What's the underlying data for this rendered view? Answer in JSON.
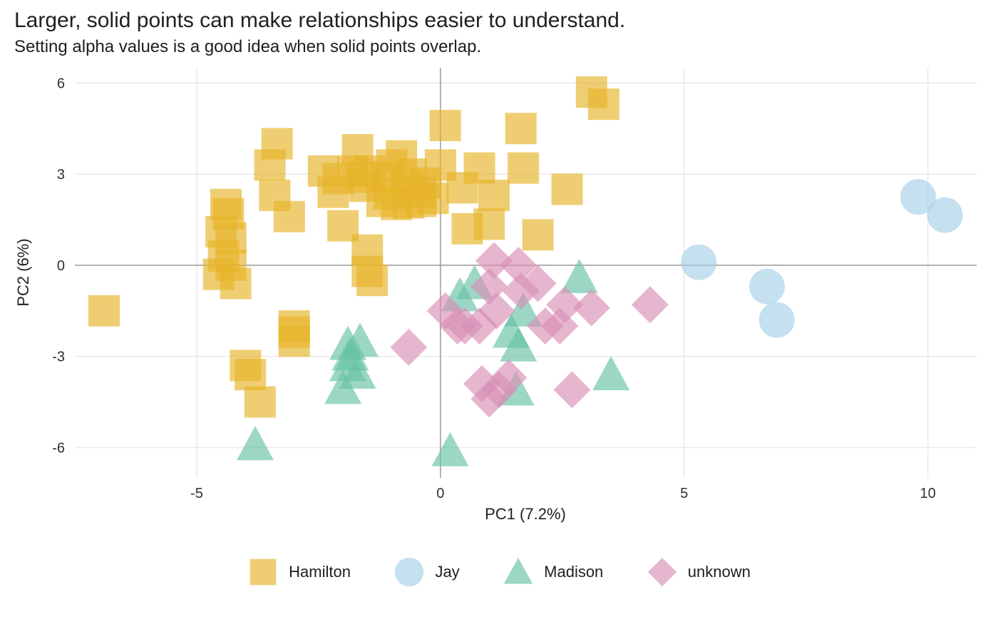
{
  "chart_data": {
    "type": "scatter",
    "title": "Larger, solid points can make relationships easier to understand.",
    "subtitle": "Setting alpha values is a good idea when solid points overlap.",
    "xlabel": "PC1 (7.2%)",
    "ylabel": "PC2 (6%)",
    "xlim": [
      -7.5,
      11
    ],
    "ylim": [
      -7,
      6.5
    ],
    "x_ticks": [
      -5,
      0,
      5,
      10
    ],
    "y_ticks": [
      -6,
      -3,
      0,
      3,
      6
    ],
    "grid": true,
    "alpha": 0.65,
    "legend_position": "bottom",
    "series": [
      {
        "name": "Hamilton",
        "shape": "square",
        "color": "#E7B428",
        "points": [
          {
            "x": -6.9,
            "y": -1.5
          },
          {
            "x": -4.4,
            "y": 2.0
          },
          {
            "x": -4.35,
            "y": 1.7
          },
          {
            "x": -4.5,
            "y": 1.1
          },
          {
            "x": -4.3,
            "y": 0.9
          },
          {
            "x": -4.45,
            "y": 0.3
          },
          {
            "x": -4.3,
            "y": 0.0
          },
          {
            "x": -4.55,
            "y": -0.3
          },
          {
            "x": -4.2,
            "y": -0.6
          },
          {
            "x": -4.0,
            "y": -3.3
          },
          {
            "x": -3.9,
            "y": -3.6
          },
          {
            "x": -3.7,
            "y": -4.5
          },
          {
            "x": -3.35,
            "y": 4.0
          },
          {
            "x": -3.5,
            "y": 3.3
          },
          {
            "x": -3.4,
            "y": 2.3
          },
          {
            "x": -3.1,
            "y": 1.6
          },
          {
            "x": -3.0,
            "y": -2.0
          },
          {
            "x": -3.0,
            "y": -2.2
          },
          {
            "x": -3.0,
            "y": -2.5
          },
          {
            "x": -2.4,
            "y": 3.1
          },
          {
            "x": -2.2,
            "y": 2.4
          },
          {
            "x": -2.0,
            "y": 1.3
          },
          {
            "x": -2.1,
            "y": 2.85
          },
          {
            "x": -1.8,
            "y": 3.1
          },
          {
            "x": -1.7,
            "y": 3.8
          },
          {
            "x": -1.6,
            "y": 2.9
          },
          {
            "x": -1.55,
            "y": 2.6
          },
          {
            "x": -1.45,
            "y": 3.1
          },
          {
            "x": -1.5,
            "y": -0.2
          },
          {
            "x": -1.4,
            "y": -0.5
          },
          {
            "x": -1.5,
            "y": 0.5
          },
          {
            "x": -1.1,
            "y": 2.9
          },
          {
            "x": -1.05,
            "y": 2.35
          },
          {
            "x": -1.2,
            "y": 2.1
          },
          {
            "x": -1.0,
            "y": 3.3
          },
          {
            "x": -0.9,
            "y": 2.0
          },
          {
            "x": -0.8,
            "y": 3.6
          },
          {
            "x": -0.7,
            "y": 2.6
          },
          {
            "x": -0.65,
            "y": 2.05
          },
          {
            "x": -0.6,
            "y": 3.0
          },
          {
            "x": -0.4,
            "y": 2.1
          },
          {
            "x": -0.4,
            "y": 2.4
          },
          {
            "x": -0.3,
            "y": 2.7
          },
          {
            "x": -0.15,
            "y": 2.2
          },
          {
            "x": 0.1,
            "y": 4.6
          },
          {
            "x": 0.0,
            "y": 3.3
          },
          {
            "x": 0.45,
            "y": 2.55
          },
          {
            "x": 0.55,
            "y": 1.2
          },
          {
            "x": 0.8,
            "y": 3.2
          },
          {
            "x": 1.0,
            "y": 1.35
          },
          {
            "x": 1.1,
            "y": 2.3
          },
          {
            "x": 1.7,
            "y": 3.2
          },
          {
            "x": 1.65,
            "y": 4.5
          },
          {
            "x": 2.0,
            "y": 1.0
          },
          {
            "x": 2.6,
            "y": 2.5
          },
          {
            "x": 3.1,
            "y": 5.7
          },
          {
            "x": 3.35,
            "y": 5.3
          }
        ]
      },
      {
        "name": "Jay",
        "shape": "circle",
        "color": "#A6CFE6",
        "points": [
          {
            "x": 5.3,
            "y": 0.1
          },
          {
            "x": 6.7,
            "y": -0.7
          },
          {
            "x": 6.9,
            "y": -1.8
          },
          {
            "x": 9.8,
            "y": 2.25
          },
          {
            "x": 10.35,
            "y": 1.65
          }
        ]
      },
      {
        "name": "Madison",
        "shape": "triangle",
        "color": "#66C2A5",
        "points": [
          {
            "x": -3.8,
            "y": -5.9
          },
          {
            "x": -1.9,
            "y": -2.6
          },
          {
            "x": -1.85,
            "y": -2.95
          },
          {
            "x": -1.9,
            "y": -3.3
          },
          {
            "x": -2.0,
            "y": -4.05
          },
          {
            "x": -1.65,
            "y": -2.5
          },
          {
            "x": -1.7,
            "y": -3.55
          },
          {
            "x": 0.2,
            "y": -6.1
          },
          {
            "x": 0.4,
            "y": -1.0
          },
          {
            "x": 0.7,
            "y": -0.6
          },
          {
            "x": 1.45,
            "y": -2.2
          },
          {
            "x": 1.6,
            "y": -2.65
          },
          {
            "x": 1.7,
            "y": -1.5
          },
          {
            "x": 1.55,
            "y": -4.1
          },
          {
            "x": 2.85,
            "y": -0.4
          },
          {
            "x": 3.5,
            "y": -3.6
          }
        ]
      },
      {
        "name": "unknown",
        "shape": "diamond",
        "color": "#D98FB5",
        "points": [
          {
            "x": -0.65,
            "y": -2.7
          },
          {
            "x": 0.1,
            "y": -1.5
          },
          {
            "x": 0.35,
            "y": -2.0
          },
          {
            "x": 0.5,
            "y": -2.0
          },
          {
            "x": 0.8,
            "y": -2.0
          },
          {
            "x": 0.85,
            "y": -3.9
          },
          {
            "x": 1.0,
            "y": -4.4
          },
          {
            "x": 1.0,
            "y": -0.7
          },
          {
            "x": 1.1,
            "y": 0.15
          },
          {
            "x": 1.15,
            "y": -1.5
          },
          {
            "x": 1.2,
            "y": -4.1
          },
          {
            "x": 1.4,
            "y": -3.7
          },
          {
            "x": 1.6,
            "y": 0.0
          },
          {
            "x": 1.65,
            "y": -0.85
          },
          {
            "x": 2.0,
            "y": -0.6
          },
          {
            "x": 2.15,
            "y": -2.0
          },
          {
            "x": 2.45,
            "y": -2.0
          },
          {
            "x": 2.55,
            "y": -1.3
          },
          {
            "x": 2.7,
            "y": -4.1
          },
          {
            "x": 3.1,
            "y": -1.4
          },
          {
            "x": 4.3,
            "y": -1.3
          }
        ]
      }
    ]
  }
}
